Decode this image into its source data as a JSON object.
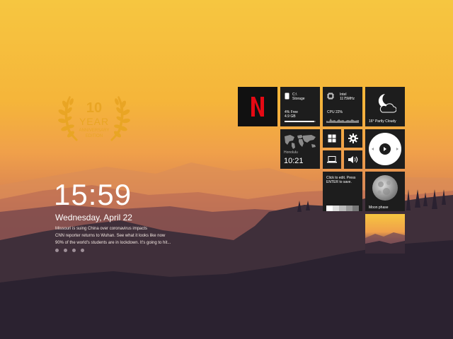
{
  "badge": {
    "number": "10",
    "year": "YEAR",
    "sub1": "ANNIVERSARY",
    "sub2": "EDITION"
  },
  "clock": {
    "time": "15:59",
    "date": "Wednesday, April 22"
  },
  "news": {
    "line1": "Missouri is suing China over coronavirus impacts",
    "line2": "CNN reporter returns to Wuhan. See what it looks like now",
    "line3": "90% of the world's students are in lockdown. It's going to hit..."
  },
  "pager": {
    "count": 4
  },
  "tiles": {
    "netflix": {
      "icon": "netflix-logo",
      "letter": "N",
      "color": "#e50914"
    },
    "storage": {
      "drive": "C:\\",
      "label": "Storage",
      "free": "4% Free",
      "size": "4.9 GB",
      "used_fraction": 0.96
    },
    "cpu": {
      "name": "Intel",
      "freq": "1175MHz",
      "usage": "CPU 22%",
      "usage_fraction": 0.22
    },
    "weather": {
      "icon": "moon-cloud-icon",
      "text": "16° Partly Cloudy"
    },
    "worldclock": {
      "icon": "world-map-icon",
      "city": "Honolulu",
      "time": "10:21"
    },
    "windows": {
      "icon": "windows-logo-icon"
    },
    "settings": {
      "icon": "gear-icon"
    },
    "computer": {
      "icon": "laptop-icon"
    },
    "volume": {
      "icon": "speaker-icon"
    },
    "media": {
      "icon": "media-wheel-icon"
    },
    "notes": {
      "text1": "Click to edit. Press",
      "text2": "ENTER to save."
    },
    "moon": {
      "icon": "moon-icon",
      "label": "Moon phase"
    },
    "photo": {
      "icon": "photo-thumbnail"
    }
  }
}
